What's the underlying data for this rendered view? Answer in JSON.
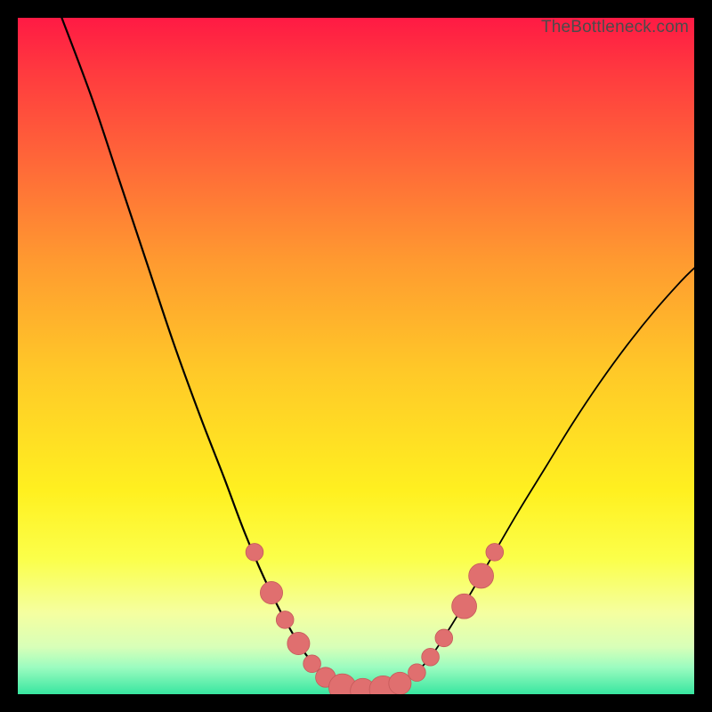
{
  "watermark": "TheBottleneck.com",
  "colors": {
    "frame_border": "#000000",
    "curve": "#000000",
    "marker_fill": "#e06f6f",
    "marker_stroke": "#c55a5a",
    "gradient_stops": [
      "#ff1a44",
      "#ff3a3f",
      "#ff6a38",
      "#ff9a30",
      "#ffc828",
      "#fff020",
      "#fbff4a",
      "#f5ffa0",
      "#d8ffb8",
      "#9cfcc0",
      "#38e6a0"
    ]
  },
  "chart_data": {
    "type": "line",
    "title": "",
    "xlabel": "",
    "ylabel": "",
    "xlim": [
      0,
      100
    ],
    "ylim": [
      0,
      100
    ],
    "left_curve": [
      {
        "x": 6.5,
        "y": 100
      },
      {
        "x": 11,
        "y": 88
      },
      {
        "x": 15,
        "y": 76
      },
      {
        "x": 19,
        "y": 64
      },
      {
        "x": 23,
        "y": 52
      },
      {
        "x": 27,
        "y": 41
      },
      {
        "x": 30.5,
        "y": 32
      },
      {
        "x": 33.5,
        "y": 24
      },
      {
        "x": 36.5,
        "y": 17
      },
      {
        "x": 39.5,
        "y": 11
      },
      {
        "x": 42.5,
        "y": 6
      },
      {
        "x": 45.5,
        "y": 2.5
      },
      {
        "x": 48.5,
        "y": 0.8
      },
      {
        "x": 52,
        "y": 0.4
      }
    ],
    "right_curve": [
      {
        "x": 52,
        "y": 0.4
      },
      {
        "x": 55,
        "y": 0.8
      },
      {
        "x": 58,
        "y": 2.4
      },
      {
        "x": 61,
        "y": 5.5
      },
      {
        "x": 64,
        "y": 10
      },
      {
        "x": 67,
        "y": 15
      },
      {
        "x": 70.5,
        "y": 21
      },
      {
        "x": 74,
        "y": 27
      },
      {
        "x": 78,
        "y": 33.5
      },
      {
        "x": 82,
        "y": 40
      },
      {
        "x": 86,
        "y": 46
      },
      {
        "x": 90,
        "y": 51.5
      },
      {
        "x": 94,
        "y": 56.5
      },
      {
        "x": 98,
        "y": 61
      },
      {
        "x": 100,
        "y": 63
      }
    ],
    "markers": [
      {
        "x": 35,
        "y": 21,
        "r": 1.0
      },
      {
        "x": 37.5,
        "y": 15,
        "r": 1.4
      },
      {
        "x": 39.5,
        "y": 11,
        "r": 1.0
      },
      {
        "x": 41.5,
        "y": 7.5,
        "r": 1.4
      },
      {
        "x": 43.5,
        "y": 4.5,
        "r": 1.0
      },
      {
        "x": 45.5,
        "y": 2.5,
        "r": 1.2
      },
      {
        "x": 48,
        "y": 1.0,
        "r": 1.8
      },
      {
        "x": 51,
        "y": 0.5,
        "r": 1.6
      },
      {
        "x": 54,
        "y": 0.7,
        "r": 1.8
      },
      {
        "x": 56.5,
        "y": 1.6,
        "r": 1.4
      },
      {
        "x": 59,
        "y": 3.2,
        "r": 1.0
      },
      {
        "x": 61,
        "y": 5.5,
        "r": 1.0
      },
      {
        "x": 63,
        "y": 8.3,
        "r": 1.0
      },
      {
        "x": 66,
        "y": 13,
        "r": 1.6
      },
      {
        "x": 68.5,
        "y": 17.5,
        "r": 1.6
      },
      {
        "x": 70.5,
        "y": 21,
        "r": 1.0
      }
    ]
  }
}
